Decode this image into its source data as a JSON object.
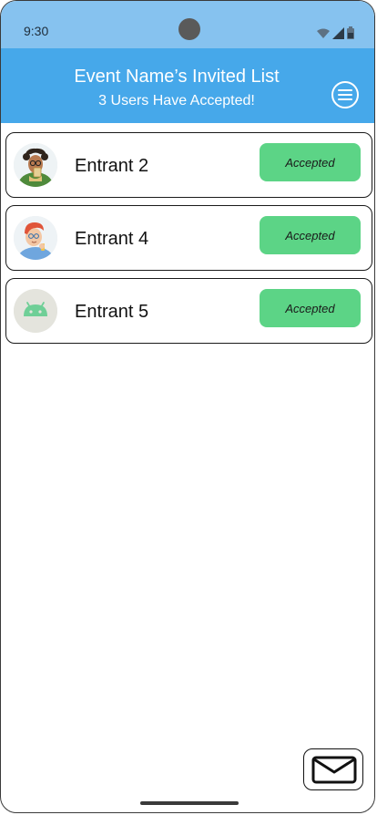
{
  "status_bar": {
    "time": "9:30"
  },
  "header": {
    "title": "Event Name’s Invited List",
    "subtitle": "3 Users Have Accepted!",
    "background": "#46a8ea"
  },
  "entrants": [
    {
      "name": "Entrant 2",
      "status": "Accepted",
      "avatar": "person-with-drink-avatar"
    },
    {
      "name": "Entrant 4",
      "status": "Accepted",
      "avatar": "red-hair-person-avatar"
    },
    {
      "name": "Entrant 5",
      "status": "Accepted",
      "avatar": "android-robot-avatar"
    }
  ],
  "colors": {
    "accepted": "#5cd486",
    "status_bar": "#86c2ef"
  },
  "icons": {
    "menu": "hamburger-menu-icon",
    "mail": "envelope-icon"
  }
}
